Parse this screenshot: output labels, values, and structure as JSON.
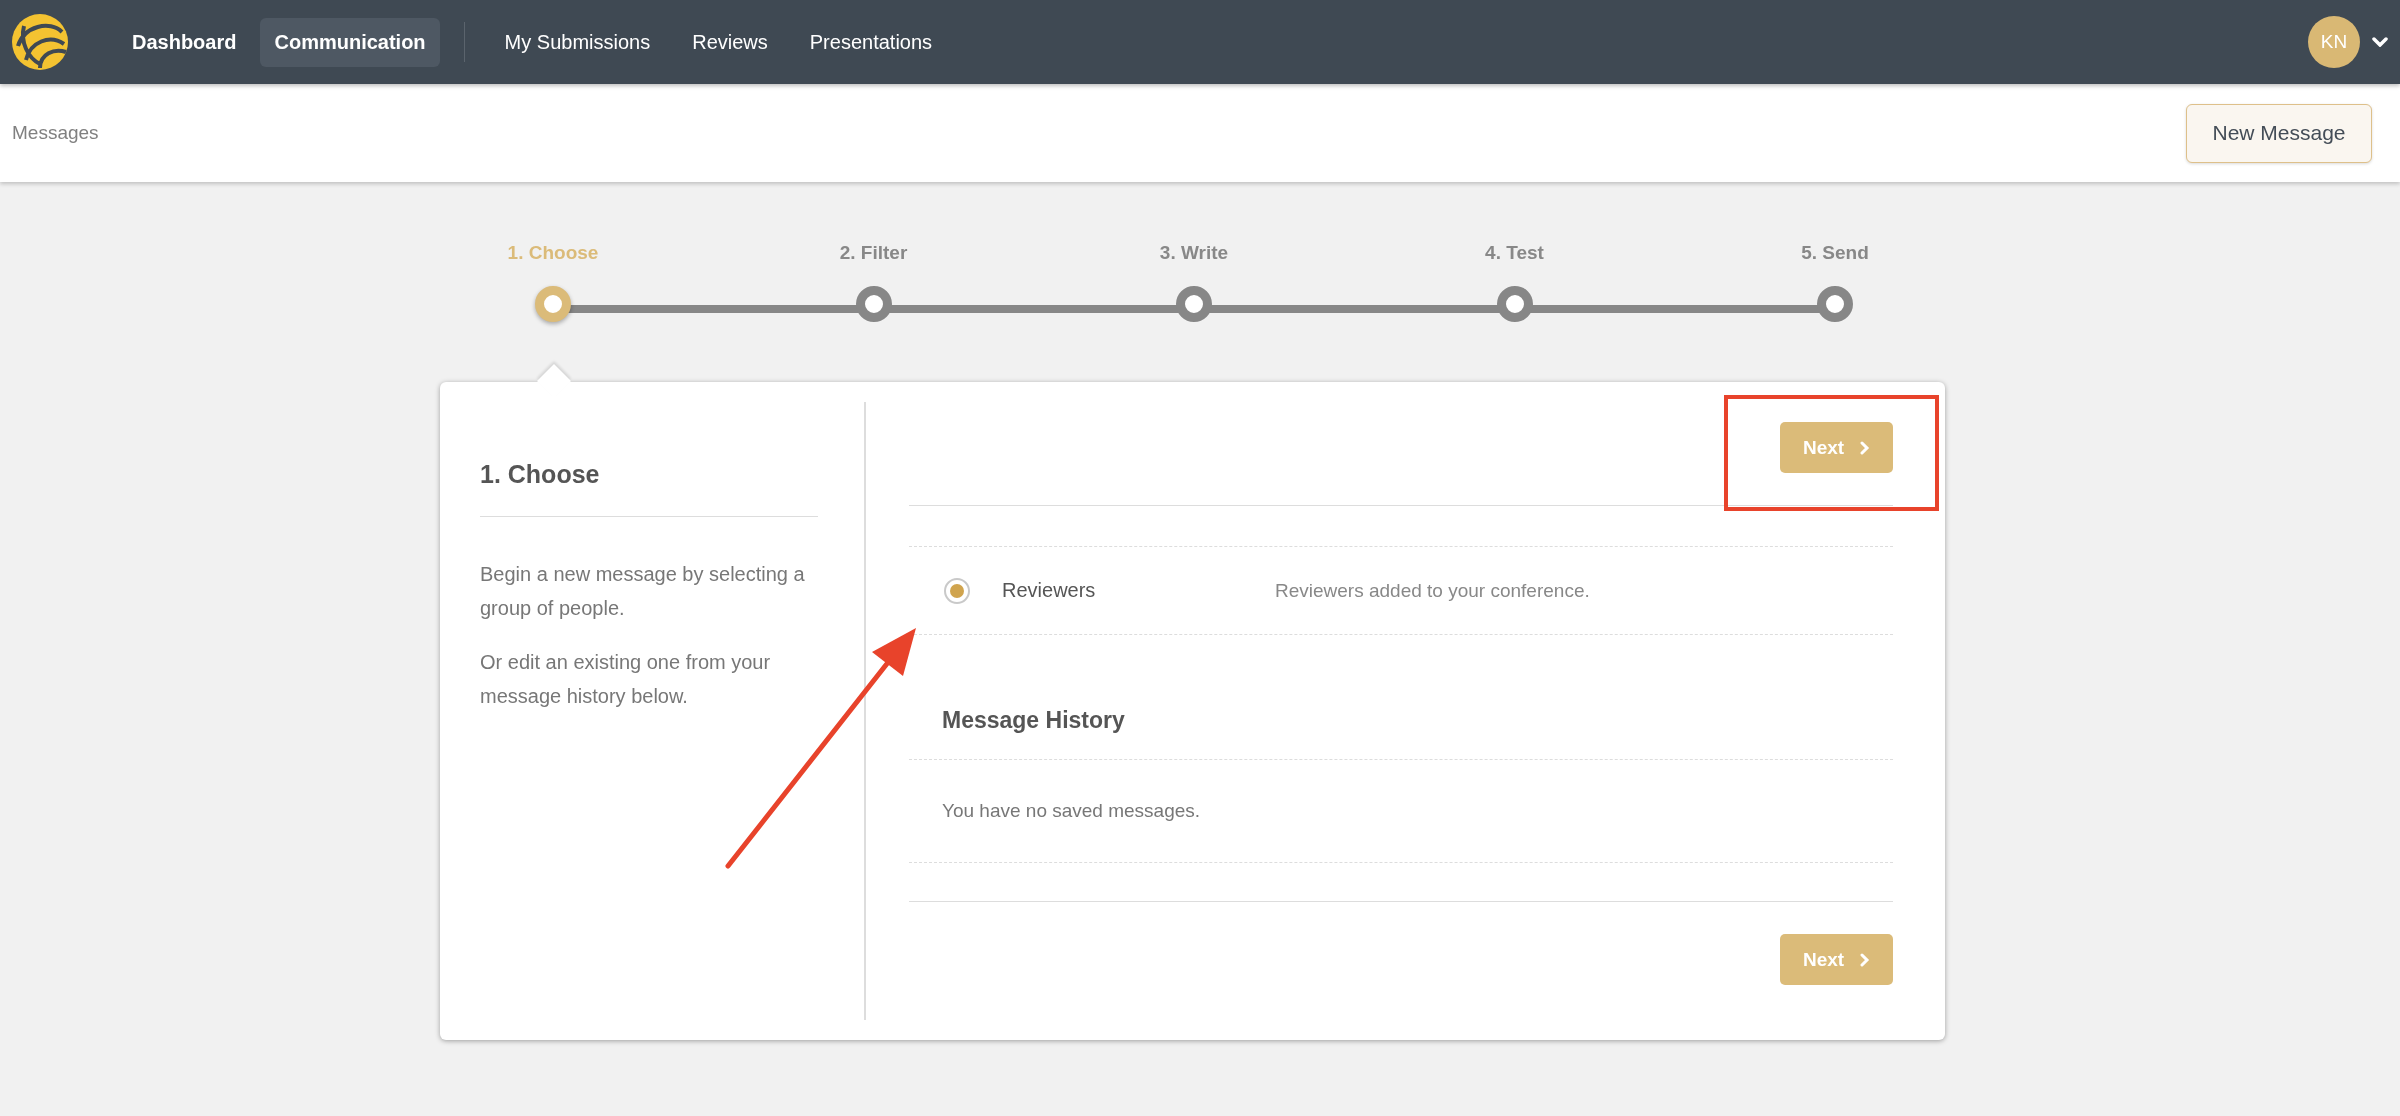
{
  "nav": {
    "items": [
      {
        "label": "Dashboard",
        "kind": "primary",
        "selected": false
      },
      {
        "label": "Communication",
        "kind": "primary",
        "selected": true
      },
      {
        "label": "My Submissions",
        "kind": "secondary",
        "selected": false
      },
      {
        "label": "Reviews",
        "kind": "secondary",
        "selected": false
      },
      {
        "label": "Presentations",
        "kind": "secondary",
        "selected": false
      }
    ]
  },
  "user": {
    "initials": "KN"
  },
  "subheader": {
    "title": "Messages",
    "button": "New Message"
  },
  "steps": [
    {
      "label": "1. Choose",
      "selected": true
    },
    {
      "label": "2. Filter",
      "selected": false
    },
    {
      "label": "3. Write",
      "selected": false
    },
    {
      "label": "4. Test",
      "selected": false
    },
    {
      "label": "5. Send",
      "selected": false
    }
  ],
  "panel": {
    "title": "1. Choose",
    "paragraphs": [
      "Begin a new message by selecting a group of people.",
      "Or edit an existing one from your message history below."
    ],
    "top_button": "Next",
    "bottom_button": "Next",
    "groups": [
      {
        "name": "Reviewers",
        "description": "Reviewers added to your conference.",
        "selected": true
      }
    ],
    "history": {
      "title": "Message History",
      "empty_text": "You have no saved messages."
    }
  }
}
